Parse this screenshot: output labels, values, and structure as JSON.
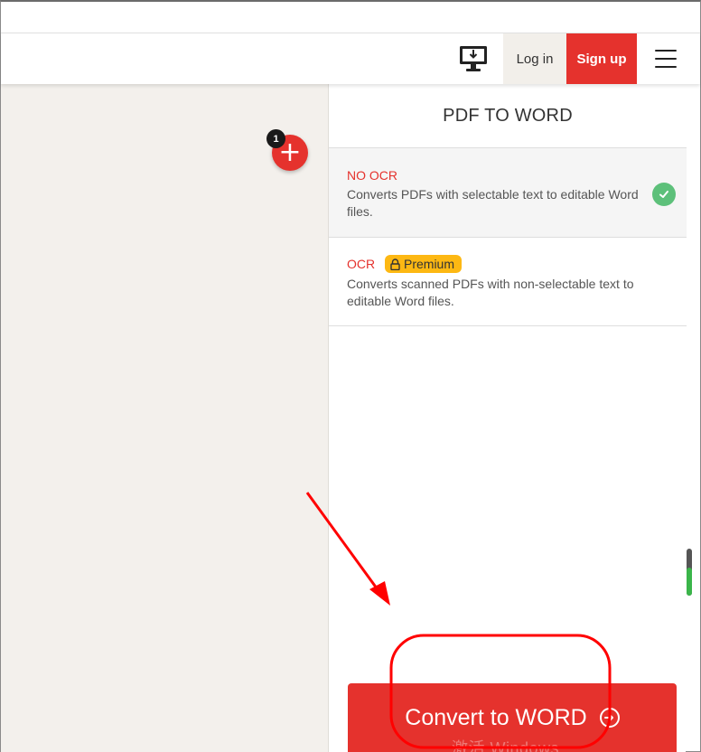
{
  "header": {
    "login_label": "Log in",
    "signup_label": "Sign up",
    "icons": [
      "desktop-download-icon",
      "hamburger-menu-icon"
    ]
  },
  "files": {
    "count": "1",
    "add_icon": "plus-icon"
  },
  "panel": {
    "title": "PDF TO WORD",
    "options": [
      {
        "title": "NO OCR",
        "description": "Converts PDFs with selectable text to editable Word files.",
        "selected": true,
        "status_icon": "check-icon"
      },
      {
        "title": "OCR",
        "badge": "Premium",
        "badge_icon": "lock-icon",
        "description": "Converts scanned PDFs with non-selectable text to editable Word files.",
        "selected": false
      }
    ],
    "convert_label": "Convert to WORD",
    "convert_icon": "arrow-right-circle-icon"
  },
  "overlay": {
    "watermark": "激活 Windows"
  },
  "colors": {
    "brand_red": "#e5322d",
    "premium_yellow": "#fdb813",
    "check_green": "#5dc07a",
    "left_pane_bg": "#f3f0ec",
    "annotation_red": "#ff0000"
  }
}
